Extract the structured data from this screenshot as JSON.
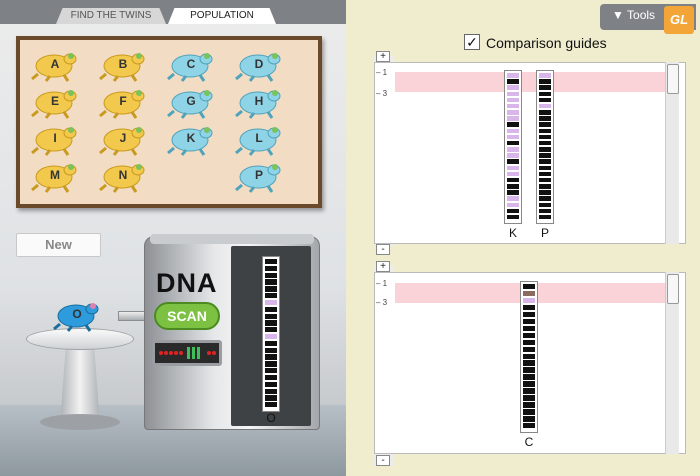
{
  "tabs": [
    {
      "label": "FIND THE TWINS",
      "active": false
    },
    {
      "label": "POPULATION",
      "active": true
    }
  ],
  "tools": {
    "label": "Tools",
    "logo": "GL"
  },
  "frogs": [
    {
      "id": "A",
      "color": "yellow"
    },
    {
      "id": "B",
      "color": "yellow"
    },
    {
      "id": "C",
      "color": "blue"
    },
    {
      "id": "D",
      "color": "blue"
    },
    {
      "id": "E",
      "color": "yellow"
    },
    {
      "id": "F",
      "color": "yellow"
    },
    {
      "id": "G",
      "color": "blue"
    },
    {
      "id": "H",
      "color": "blue"
    },
    {
      "id": "I",
      "color": "yellow"
    },
    {
      "id": "J",
      "color": "yellow"
    },
    {
      "id": "K",
      "color": "blue"
    },
    {
      "id": "L",
      "color": "blue"
    },
    {
      "id": "M",
      "color": "yellow"
    },
    {
      "id": "N",
      "color": "yellow"
    },
    {
      "id": "P",
      "color": "blue"
    }
  ],
  "new_button": "New",
  "scanner": {
    "title": "DNA",
    "scan_label": "SCAN",
    "frog_label": "O",
    "strip_label": "O"
  },
  "comparison_guides": {
    "label": "Comparison guides",
    "checked": true
  },
  "ruler": {
    "marks": [
      "1",
      "3"
    ],
    "plus": "+",
    "minus": "-"
  },
  "top_panel": {
    "strips": [
      "K",
      "P"
    ]
  },
  "bottom_panel": {
    "strips": [
      "C"
    ]
  },
  "colors": {
    "yellow_frog": "#f2c94c",
    "blue_frog": "#8fd3e6",
    "lavender": "#d9b6ea",
    "black": "#111111",
    "brown": "#8b6b60",
    "guide": "#f9d3d8"
  },
  "sequences": {
    "K": "lbllllllbllbllbllbbbllbb",
    "P": "lbbbblbbbbbbbbbbbbbbbbbb",
    "C": "bnlbbbbbbbbbbbbbbbbbb",
    "O": "bbbbbblbbbblbbbbbbbbbb"
  }
}
